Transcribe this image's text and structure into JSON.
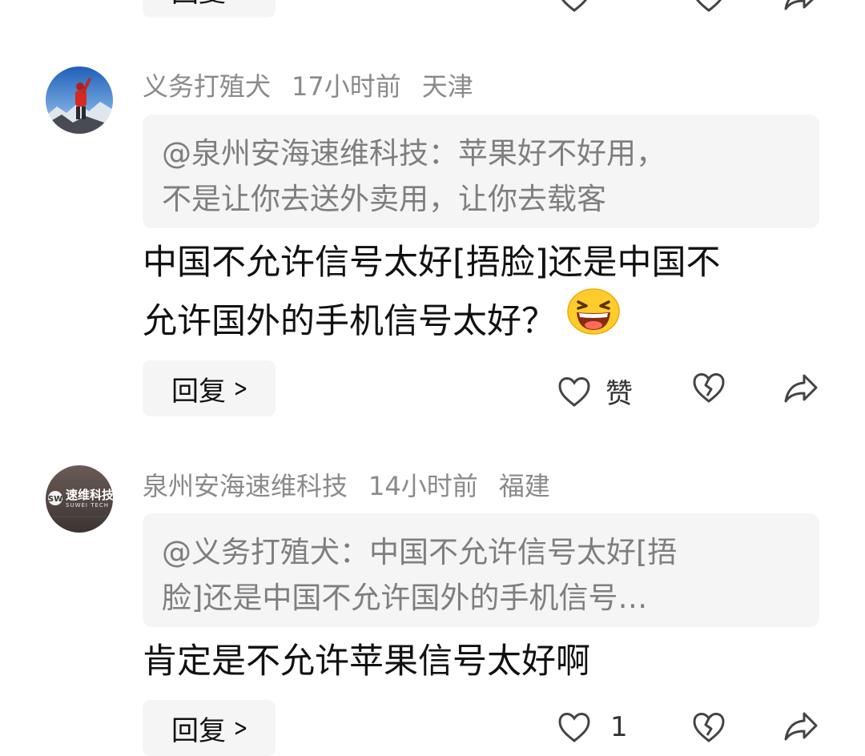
{
  "top_partial": {
    "reply_label": "回复"
  },
  "comment1": {
    "username": "义务打殖犬",
    "time": "17小时前",
    "location": "天津",
    "quote_lines": [
      "@泉州安海速维科技：苹果好不好用，",
      "不是让你去送外卖用，让你去载客"
    ],
    "body_lines": [
      "中国不允许信号太好[捂脸]还是中国不",
      "允许国外的手机信号太好？"
    ],
    "emoji": "laughing-face-emoji",
    "reply_label": "回复",
    "like_label": "赞"
  },
  "comment2": {
    "username": "泉州安海速维科技",
    "time": "14小时前",
    "location": "福建",
    "avatar_text": "速维科技",
    "avatar_subtext": "SUWEI TECH",
    "quote_lines": [
      "@义务打殖犬：中国不允许信号太好[捂",
      "脸]还是中国不允许国外的手机信号…"
    ],
    "body_lines": [
      "肯定是不允许苹果信号太好啊"
    ],
    "reply_label": "回复",
    "like_count": "1"
  },
  "colors": {
    "meta_gray": "#8a8a8a",
    "quote_bg": "#f5f5f5",
    "quote_text": "#7e7e7e",
    "body_text": "#111111"
  }
}
